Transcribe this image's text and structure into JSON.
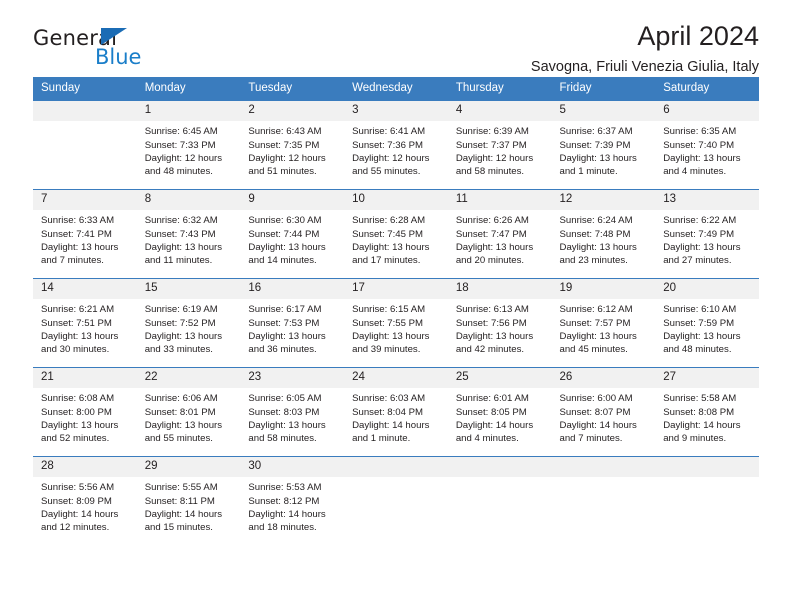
{
  "brand": {
    "name_part1": "General",
    "name_part2": "Blue",
    "triangle_icon": "triangle-icon",
    "accent_color": "#1a7ec9"
  },
  "header": {
    "title": "April 2024",
    "subtitle": "Savogna, Friuli Venezia Giulia, Italy"
  },
  "calendar": {
    "header_bg": "#3a7cbe",
    "daynum_bg": "#f1f1f1",
    "weekdays": [
      "Sunday",
      "Monday",
      "Tuesday",
      "Wednesday",
      "Thursday",
      "Friday",
      "Saturday"
    ],
    "weeks": [
      [
        {
          "day": "",
          "sunrise": "",
          "sunset": "",
          "daylight1": "",
          "daylight2": ""
        },
        {
          "day": "1",
          "sunrise": "Sunrise: 6:45 AM",
          "sunset": "Sunset: 7:33 PM",
          "daylight1": "Daylight: 12 hours",
          "daylight2": "and 48 minutes."
        },
        {
          "day": "2",
          "sunrise": "Sunrise: 6:43 AM",
          "sunset": "Sunset: 7:35 PM",
          "daylight1": "Daylight: 12 hours",
          "daylight2": "and 51 minutes."
        },
        {
          "day": "3",
          "sunrise": "Sunrise: 6:41 AM",
          "sunset": "Sunset: 7:36 PM",
          "daylight1": "Daylight: 12 hours",
          "daylight2": "and 55 minutes."
        },
        {
          "day": "4",
          "sunrise": "Sunrise: 6:39 AM",
          "sunset": "Sunset: 7:37 PM",
          "daylight1": "Daylight: 12 hours",
          "daylight2": "and 58 minutes."
        },
        {
          "day": "5",
          "sunrise": "Sunrise: 6:37 AM",
          "sunset": "Sunset: 7:39 PM",
          "daylight1": "Daylight: 13 hours",
          "daylight2": "and 1 minute."
        },
        {
          "day": "6",
          "sunrise": "Sunrise: 6:35 AM",
          "sunset": "Sunset: 7:40 PM",
          "daylight1": "Daylight: 13 hours",
          "daylight2": "and 4 minutes."
        }
      ],
      [
        {
          "day": "7",
          "sunrise": "Sunrise: 6:33 AM",
          "sunset": "Sunset: 7:41 PM",
          "daylight1": "Daylight: 13 hours",
          "daylight2": "and 7 minutes."
        },
        {
          "day": "8",
          "sunrise": "Sunrise: 6:32 AM",
          "sunset": "Sunset: 7:43 PM",
          "daylight1": "Daylight: 13 hours",
          "daylight2": "and 11 minutes."
        },
        {
          "day": "9",
          "sunrise": "Sunrise: 6:30 AM",
          "sunset": "Sunset: 7:44 PM",
          "daylight1": "Daylight: 13 hours",
          "daylight2": "and 14 minutes."
        },
        {
          "day": "10",
          "sunrise": "Sunrise: 6:28 AM",
          "sunset": "Sunset: 7:45 PM",
          "daylight1": "Daylight: 13 hours",
          "daylight2": "and 17 minutes."
        },
        {
          "day": "11",
          "sunrise": "Sunrise: 6:26 AM",
          "sunset": "Sunset: 7:47 PM",
          "daylight1": "Daylight: 13 hours",
          "daylight2": "and 20 minutes."
        },
        {
          "day": "12",
          "sunrise": "Sunrise: 6:24 AM",
          "sunset": "Sunset: 7:48 PM",
          "daylight1": "Daylight: 13 hours",
          "daylight2": "and 23 minutes."
        },
        {
          "day": "13",
          "sunrise": "Sunrise: 6:22 AM",
          "sunset": "Sunset: 7:49 PM",
          "daylight1": "Daylight: 13 hours",
          "daylight2": "and 27 minutes."
        }
      ],
      [
        {
          "day": "14",
          "sunrise": "Sunrise: 6:21 AM",
          "sunset": "Sunset: 7:51 PM",
          "daylight1": "Daylight: 13 hours",
          "daylight2": "and 30 minutes."
        },
        {
          "day": "15",
          "sunrise": "Sunrise: 6:19 AM",
          "sunset": "Sunset: 7:52 PM",
          "daylight1": "Daylight: 13 hours",
          "daylight2": "and 33 minutes."
        },
        {
          "day": "16",
          "sunrise": "Sunrise: 6:17 AM",
          "sunset": "Sunset: 7:53 PM",
          "daylight1": "Daylight: 13 hours",
          "daylight2": "and 36 minutes."
        },
        {
          "day": "17",
          "sunrise": "Sunrise: 6:15 AM",
          "sunset": "Sunset: 7:55 PM",
          "daylight1": "Daylight: 13 hours",
          "daylight2": "and 39 minutes."
        },
        {
          "day": "18",
          "sunrise": "Sunrise: 6:13 AM",
          "sunset": "Sunset: 7:56 PM",
          "daylight1": "Daylight: 13 hours",
          "daylight2": "and 42 minutes."
        },
        {
          "day": "19",
          "sunrise": "Sunrise: 6:12 AM",
          "sunset": "Sunset: 7:57 PM",
          "daylight1": "Daylight: 13 hours",
          "daylight2": "and 45 minutes."
        },
        {
          "day": "20",
          "sunrise": "Sunrise: 6:10 AM",
          "sunset": "Sunset: 7:59 PM",
          "daylight1": "Daylight: 13 hours",
          "daylight2": "and 48 minutes."
        }
      ],
      [
        {
          "day": "21",
          "sunrise": "Sunrise: 6:08 AM",
          "sunset": "Sunset: 8:00 PM",
          "daylight1": "Daylight: 13 hours",
          "daylight2": "and 52 minutes."
        },
        {
          "day": "22",
          "sunrise": "Sunrise: 6:06 AM",
          "sunset": "Sunset: 8:01 PM",
          "daylight1": "Daylight: 13 hours",
          "daylight2": "and 55 minutes."
        },
        {
          "day": "23",
          "sunrise": "Sunrise: 6:05 AM",
          "sunset": "Sunset: 8:03 PM",
          "daylight1": "Daylight: 13 hours",
          "daylight2": "and 58 minutes."
        },
        {
          "day": "24",
          "sunrise": "Sunrise: 6:03 AM",
          "sunset": "Sunset: 8:04 PM",
          "daylight1": "Daylight: 14 hours",
          "daylight2": "and 1 minute."
        },
        {
          "day": "25",
          "sunrise": "Sunrise: 6:01 AM",
          "sunset": "Sunset: 8:05 PM",
          "daylight1": "Daylight: 14 hours",
          "daylight2": "and 4 minutes."
        },
        {
          "day": "26",
          "sunrise": "Sunrise: 6:00 AM",
          "sunset": "Sunset: 8:07 PM",
          "daylight1": "Daylight: 14 hours",
          "daylight2": "and 7 minutes."
        },
        {
          "day": "27",
          "sunrise": "Sunrise: 5:58 AM",
          "sunset": "Sunset: 8:08 PM",
          "daylight1": "Daylight: 14 hours",
          "daylight2": "and 9 minutes."
        }
      ],
      [
        {
          "day": "28",
          "sunrise": "Sunrise: 5:56 AM",
          "sunset": "Sunset: 8:09 PM",
          "daylight1": "Daylight: 14 hours",
          "daylight2": "and 12 minutes."
        },
        {
          "day": "29",
          "sunrise": "Sunrise: 5:55 AM",
          "sunset": "Sunset: 8:11 PM",
          "daylight1": "Daylight: 14 hours",
          "daylight2": "and 15 minutes."
        },
        {
          "day": "30",
          "sunrise": "Sunrise: 5:53 AM",
          "sunset": "Sunset: 8:12 PM",
          "daylight1": "Daylight: 14 hours",
          "daylight2": "and 18 minutes."
        },
        {
          "day": "",
          "sunrise": "",
          "sunset": "",
          "daylight1": "",
          "daylight2": ""
        },
        {
          "day": "",
          "sunrise": "",
          "sunset": "",
          "daylight1": "",
          "daylight2": ""
        },
        {
          "day": "",
          "sunrise": "",
          "sunset": "",
          "daylight1": "",
          "daylight2": ""
        },
        {
          "day": "",
          "sunrise": "",
          "sunset": "",
          "daylight1": "",
          "daylight2": ""
        }
      ]
    ]
  }
}
